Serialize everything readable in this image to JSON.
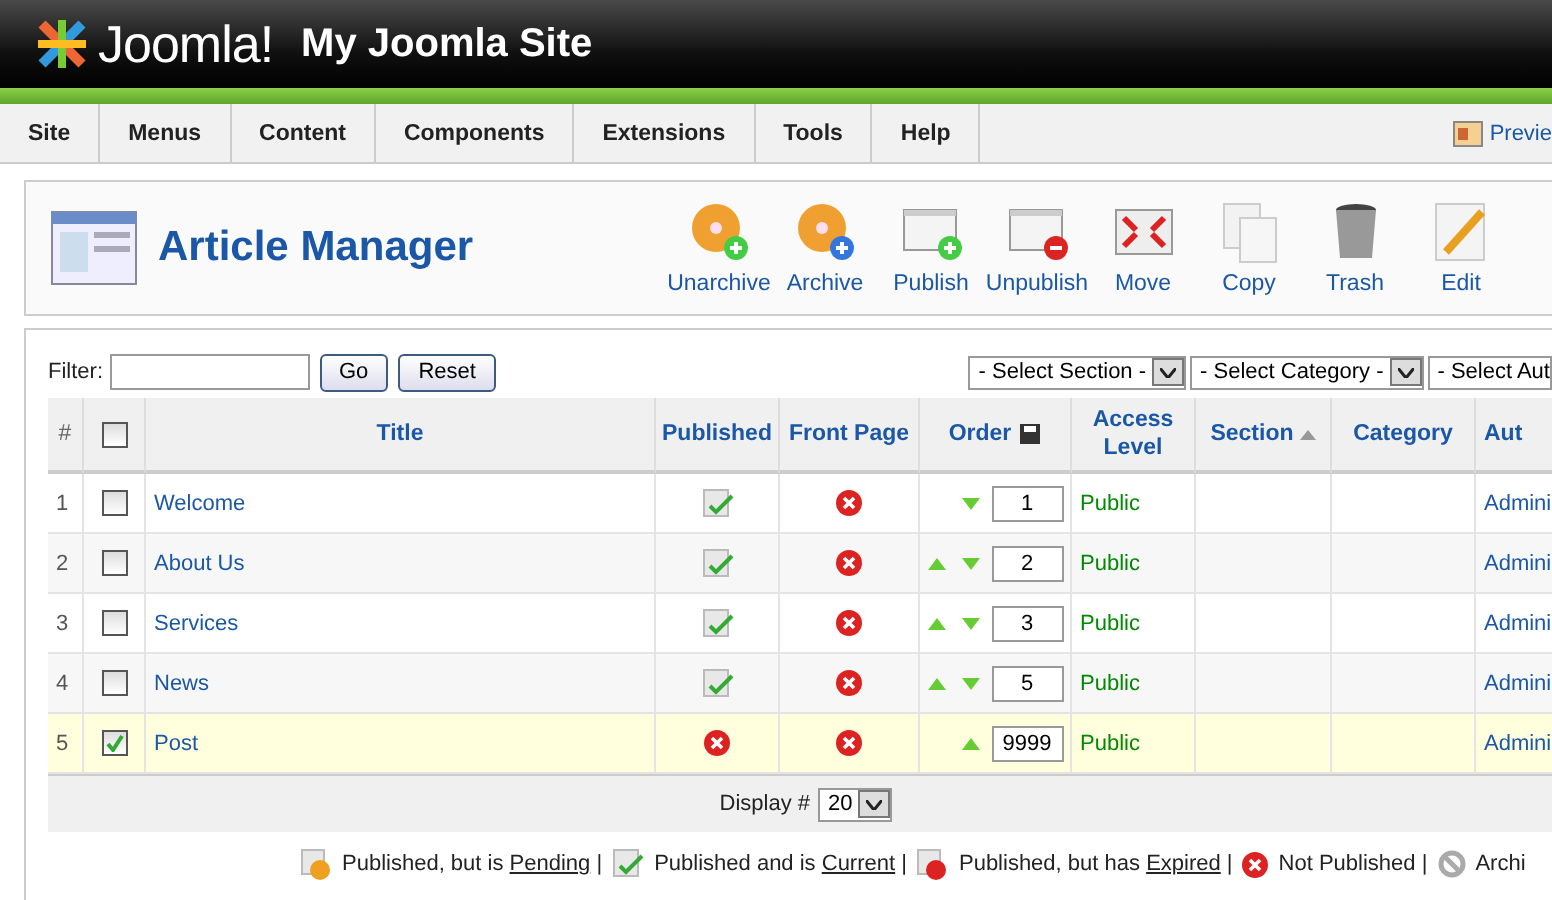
{
  "header": {
    "logo_text": "Joomla!",
    "site_name": "My Joomla Site"
  },
  "menu": [
    {
      "label": "Site"
    },
    {
      "label": "Menus"
    },
    {
      "label": "Content"
    },
    {
      "label": "Components"
    },
    {
      "label": "Extensions"
    },
    {
      "label": "Tools"
    },
    {
      "label": "Help"
    }
  ],
  "preview_link": "Previe",
  "page_title": "Article Manager",
  "toolbar": [
    {
      "kind": "unarchive",
      "label": "Unarchive"
    },
    {
      "kind": "archive",
      "label": "Archive"
    },
    {
      "kind": "publish",
      "label": "Publish"
    },
    {
      "kind": "unpublish",
      "label": "Unpublish"
    },
    {
      "kind": "move",
      "label": "Move"
    },
    {
      "kind": "copy",
      "label": "Copy"
    },
    {
      "kind": "trash",
      "label": "Trash"
    },
    {
      "kind": "edit",
      "label": "Edit"
    }
  ],
  "filter": {
    "label": "Filter:",
    "go": "Go",
    "reset": "Reset"
  },
  "selects": [
    "- Select Section -",
    "- Select Category -",
    "- Select Aut"
  ],
  "table": {
    "select_all_checked": false,
    "columns": [
      "#",
      "Title",
      "Published",
      "Front Page",
      "Order",
      "Access Level",
      "Section",
      "Category",
      "Aut"
    ],
    "rows": [
      {
        "num": "1",
        "title": "Welcome",
        "checked": false,
        "selected": false,
        "published": true,
        "front_page": false,
        "up": false,
        "down": true,
        "order": "1",
        "access": "Public",
        "author": "Admini"
      },
      {
        "num": "2",
        "title": "About Us",
        "checked": false,
        "selected": false,
        "published": true,
        "front_page": false,
        "up": true,
        "down": true,
        "order": "2",
        "access": "Public",
        "author": "Admini"
      },
      {
        "num": "3",
        "title": "Services",
        "checked": false,
        "selected": false,
        "published": true,
        "front_page": false,
        "up": true,
        "down": true,
        "order": "3",
        "access": "Public",
        "author": "Admini"
      },
      {
        "num": "4",
        "title": "News",
        "checked": false,
        "selected": false,
        "published": true,
        "front_page": false,
        "up": true,
        "down": true,
        "order": "5",
        "access": "Public",
        "author": "Admini"
      },
      {
        "num": "5",
        "title": "Post",
        "checked": true,
        "selected": true,
        "published": false,
        "front_page": false,
        "up": true,
        "down": false,
        "order": "9999",
        "access": "Public",
        "author": "Admini"
      }
    ]
  },
  "display": {
    "label": "Display #",
    "value": "20"
  },
  "legend": [
    {
      "kind": "pending",
      "text": "Published, but is",
      "link": "Pending",
      "separator": "|"
    },
    {
      "kind": "current",
      "text": "Published and is",
      "link": "Current",
      "separator": "|"
    },
    {
      "kind": "expired",
      "text": "Published, but has",
      "link": "Expired",
      "separator": "|"
    },
    {
      "kind": "unpublished",
      "text": "Not Published",
      "separator": "|"
    },
    {
      "kind": "archived",
      "text": "Archi"
    }
  ]
}
